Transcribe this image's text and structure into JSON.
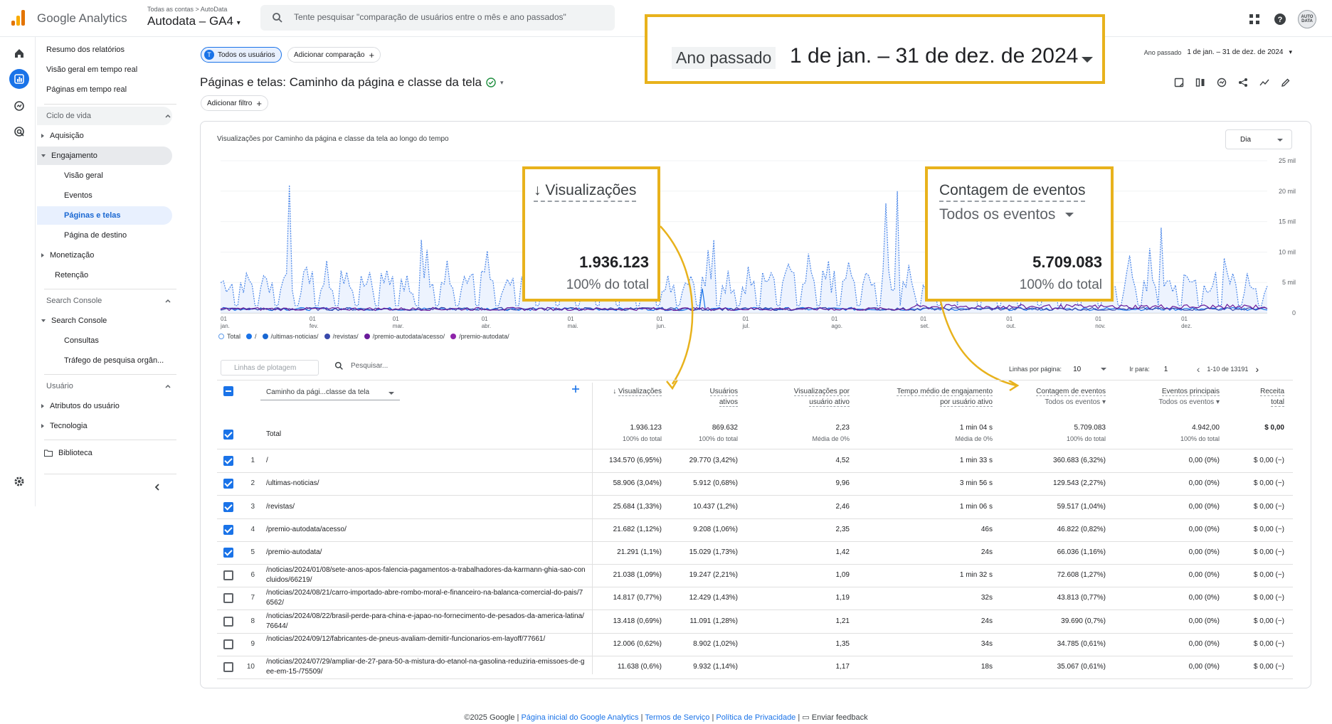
{
  "header": {
    "brand": "Google Analytics",
    "account_crumb": "Todas as contas > AutoData",
    "property": "Autodata – GA4",
    "search_placeholder": "Tente pesquisar \"comparação de usuários entre o mês e ano passados\"",
    "avatar_text": "AUTO DATA"
  },
  "nav": {
    "items": [
      {
        "label": "Resumo dos relatórios"
      },
      {
        "label": "Visão geral em tempo real"
      },
      {
        "label": "Páginas em tempo real"
      }
    ],
    "lifecycle_title": "Ciclo de vida",
    "lifecycle": [
      {
        "label": "Aquisição"
      },
      {
        "label": "Engajamento"
      },
      {
        "label": "Visão geral"
      },
      {
        "label": "Eventos"
      },
      {
        "label": "Páginas e telas"
      },
      {
        "label": "Página de destino"
      },
      {
        "label": "Monetização"
      },
      {
        "label": "Retenção"
      }
    ],
    "search_console_title": "Search Console",
    "search_console": [
      {
        "label": "Search Console"
      },
      {
        "label": "Consultas"
      },
      {
        "label": "Tráfego de pesquisa orgân..."
      }
    ],
    "user_title": "Usuário",
    "user": [
      {
        "label": "Atributos do usuário"
      },
      {
        "label": "Tecnologia"
      }
    ],
    "library": "Biblioteca"
  },
  "main": {
    "chip_all_users": "Todos os usuários",
    "chip_all_users_initial": "T",
    "chip_add_comparison": "Adicionar comparação",
    "title": "Páginas e telas: Caminho da página e classe da tela",
    "add_filter": "Adicionar filtro",
    "date_label_small": "Ano passado",
    "date_range_small": "1 de jan. – 31 de dez. de 2024",
    "highlight_date_label": "Ano passado",
    "highlight_date_range": "1 de jan. – 31 de dez. de 2024"
  },
  "chart_card": {
    "title": "Visualizações por Caminho da página e classe da tela ao longo do tempo",
    "granularity": "Dia",
    "y_ticks": [
      "25 mil",
      "20 mil",
      "15 mil",
      "10 mil",
      "5 mil",
      "0"
    ],
    "x_ticks": [
      {
        "day": "01",
        "month": "jan."
      },
      {
        "day": "01",
        "month": "fev."
      },
      {
        "day": "01",
        "month": "mar."
      },
      {
        "day": "01",
        "month": "abr."
      },
      {
        "day": "01",
        "month": "mai."
      },
      {
        "day": "01",
        "month": "jun."
      },
      {
        "day": "01",
        "month": "jul."
      },
      {
        "day": "01",
        "month": "ago."
      },
      {
        "day": "01",
        "month": "set."
      },
      {
        "day": "01",
        "month": "out."
      },
      {
        "day": "01",
        "month": "nov."
      },
      {
        "day": "01",
        "month": "dez."
      }
    ],
    "legend": [
      {
        "label": "Total",
        "color": "#5f9bea"
      },
      {
        "label": "/",
        "color": "#1a73e8"
      },
      {
        "label": "/ultimas-noticias/",
        "color": "#1967d2"
      },
      {
        "label": "/revistas/",
        "color": "#3949ab"
      },
      {
        "label": "/premio-autodata/acesso/",
        "color": "#6a1b9a"
      },
      {
        "label": "/premio-autodata/",
        "color": "#8e24aa"
      }
    ]
  },
  "callouts": {
    "views": {
      "header": "Visualizações",
      "value": "1.936.123",
      "sub": "100% do total"
    },
    "events": {
      "header": "Contagem de eventos",
      "subheader": "Todos os eventos",
      "value": "5.709.083",
      "sub": "100% do total"
    }
  },
  "table": {
    "plot_rows_placeholder": "Linhas de plotagem",
    "search_placeholder": "Pesquisar...",
    "rows_per_page_label": "Linhas por página:",
    "rows_per_page": "10",
    "goto_label": "Ir para:",
    "goto_value": "1",
    "range": "1-10 de 13191",
    "dimension": "Caminho da pági...classe da tela",
    "headers": [
      {
        "l1": "Visualizações",
        "l2": ""
      },
      {
        "l1": "Usuários",
        "l2": "ativos"
      },
      {
        "l1": "Visualizações por",
        "l2": "usuário ativo"
      },
      {
        "l1": "Tempo médio de engajamento",
        "l2": "por usuário ativo"
      },
      {
        "l1": "Contagem de eventos",
        "l2": "Todos os eventos"
      },
      {
        "l1": "Eventos principais",
        "l2": "Todos os eventos"
      },
      {
        "l1": "Receita",
        "l2": "total"
      }
    ],
    "total": {
      "label": "Total",
      "values": [
        "1.936.123",
        "869.632",
        "2,23",
        "1 min 04 s",
        "5.709.083",
        "4.942,00",
        "$ 0,00"
      ],
      "subs": [
        "100% do total",
        "100% do total",
        "Média de 0%",
        "Média de 0%",
        "100% do total",
        "100% do total",
        ""
      ]
    },
    "rows": [
      {
        "rank": "1",
        "path": "/",
        "values": [
          "134.570 (6,95%)",
          "29.770 (3,42%)",
          "4,52",
          "1 min 33 s",
          "360.683 (6,32%)",
          "0,00 (0%)",
          "$ 0,00 (−)"
        ],
        "checked": true
      },
      {
        "rank": "2",
        "path": "/ultimas-noticias/",
        "values": [
          "58.906 (3,04%)",
          "5.912 (0,68%)",
          "9,96",
          "3 min 56 s",
          "129.543 (2,27%)",
          "0,00 (0%)",
          "$ 0,00 (−)"
        ],
        "checked": true
      },
      {
        "rank": "3",
        "path": "/revistas/",
        "values": [
          "25.684 (1,33%)",
          "10.437 (1,2%)",
          "2,46",
          "1 min 06 s",
          "59.517 (1,04%)",
          "0,00 (0%)",
          "$ 0,00 (−)"
        ],
        "checked": true
      },
      {
        "rank": "4",
        "path": "/premio-autodata/acesso/",
        "values": [
          "21.682 (1,12%)",
          "9.208 (1,06%)",
          "2,35",
          "46s",
          "46.822 (0,82%)",
          "0,00 (0%)",
          "$ 0,00 (−)"
        ],
        "checked": true
      },
      {
        "rank": "5",
        "path": "/premio-autodata/",
        "values": [
          "21.291 (1,1%)",
          "15.029 (1,73%)",
          "1,42",
          "24s",
          "66.036 (1,16%)",
          "0,00 (0%)",
          "$ 0,00 (−)"
        ],
        "checked": true
      },
      {
        "rank": "6",
        "path": "/noticias/2024/01/08/sete-anos-apos-falencia-pagamentos-a-trabalhadores-da-karmann-ghia-sao-concluidos/66219/",
        "values": [
          "21.038 (1,09%)",
          "19.247 (2,21%)",
          "1,09",
          "1 min 32 s",
          "72.608 (1,27%)",
          "0,00 (0%)",
          "$ 0,00 (−)"
        ],
        "checked": false
      },
      {
        "rank": "7",
        "path": "/noticias/2024/08/21/carro-importado-abre-rombo-moral-e-financeiro-na-balanca-comercial-do-pais/76562/",
        "values": [
          "14.817 (0,77%)",
          "12.429 (1,43%)",
          "1,19",
          "32s",
          "43.813 (0,77%)",
          "0,00 (0%)",
          "$ 0,00 (−)"
        ],
        "checked": false
      },
      {
        "rank": "8",
        "path": "/noticias/2024/08/22/brasil-perde-para-china-e-japao-no-fornecimento-de-pesados-da-america-latina/76644/",
        "values": [
          "13.418 (0,69%)",
          "11.091 (1,28%)",
          "1,21",
          "24s",
          "39.690 (0,7%)",
          "0,00 (0%)",
          "$ 0,00 (−)"
        ],
        "checked": false
      },
      {
        "rank": "9",
        "path": "/noticias/2024/09/12/fabricantes-de-pneus-avaliam-demitir-funcionarios-em-layoff/77661/",
        "values": [
          "12.006 (0,62%)",
          "8.902 (1,02%)",
          "1,35",
          "34s",
          "34.785 (0,61%)",
          "0,00 (0%)",
          "$ 0,00 (−)"
        ],
        "checked": false
      },
      {
        "rank": "10",
        "path": "/noticias/2024/07/29/ampliar-de-27-para-50-a-mistura-do-etanol-na-gasolina-reduziria-emissoes-de-gee-em-15-/75509/",
        "values": [
          "11.638 (0,6%)",
          "9.932 (1,14%)",
          "1,17",
          "18s",
          "35.067 (0,61%)",
          "0,00 (0%)",
          "$ 0,00 (−)"
        ],
        "checked": false
      }
    ]
  },
  "footer": {
    "copyright": "©2025 Google",
    "home": "Página inicial do Google Analytics",
    "terms": "Termos de Serviço",
    "privacy": "Política de Privacidade",
    "feedback": "Enviar feedback",
    "sep": "|"
  }
}
